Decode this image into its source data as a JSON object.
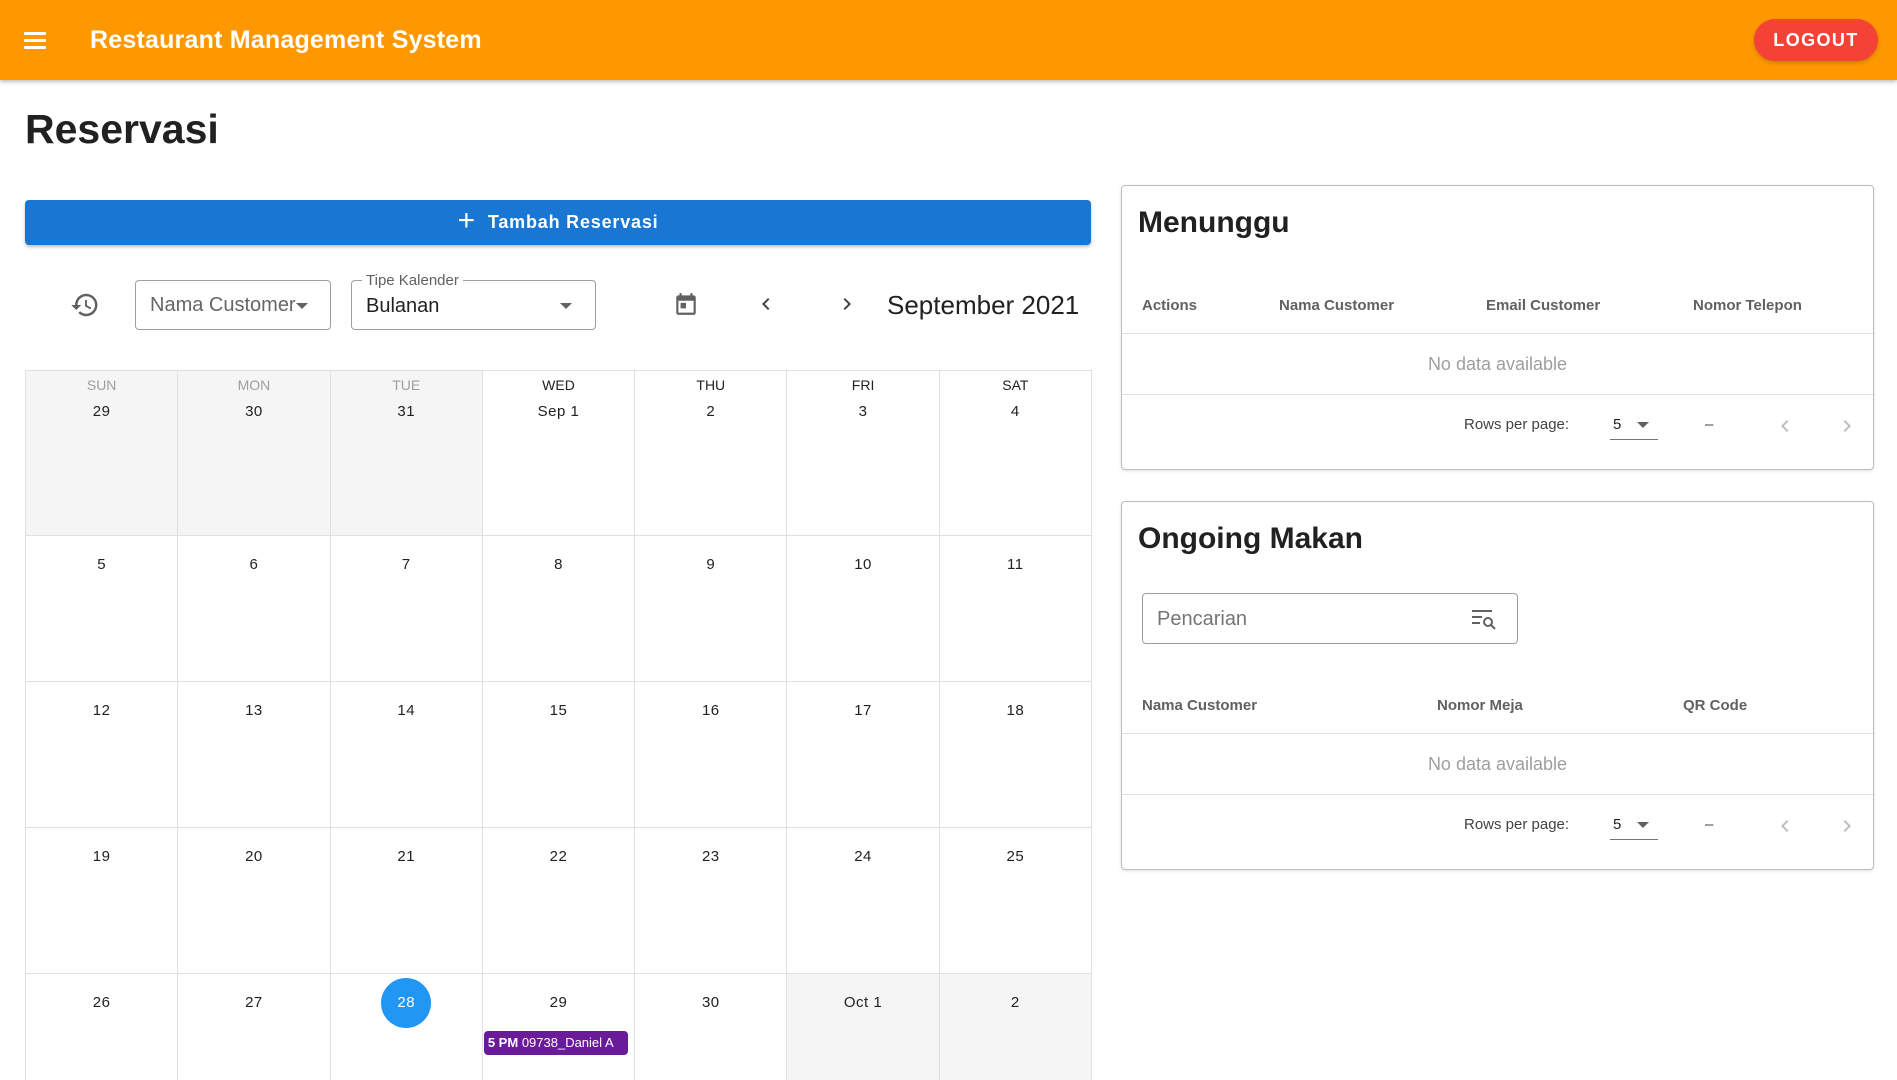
{
  "app": {
    "title": "Restaurant Management System",
    "logout_label": "LOGOUT"
  },
  "page": {
    "title": "Reservasi",
    "add_label": "Tambah Reservasi"
  },
  "toolbar": {
    "customer_select_value": "Nama Customer",
    "calendar_type_label": "Tipe Kalender",
    "calendar_type_value": "Bulanan",
    "month_title": "September 2021"
  },
  "calendar": {
    "weekdays": [
      "SUN",
      "MON",
      "TUE",
      "WED",
      "THU",
      "FRI",
      "SAT"
    ],
    "weeks": [
      [
        "29",
        "30",
        "31",
        "Sep 1",
        "2",
        "3",
        "4"
      ],
      [
        "5",
        "6",
        "7",
        "8",
        "9",
        "10",
        "11"
      ],
      [
        "12",
        "13",
        "14",
        "15",
        "16",
        "17",
        "18"
      ],
      [
        "19",
        "20",
        "21",
        "22",
        "23",
        "24",
        "25"
      ],
      [
        "26",
        "27",
        "28",
        "29",
        "30",
        "Oct 1",
        "2"
      ]
    ],
    "event": {
      "time": "5 PM",
      "title": "09738_Daniel A"
    }
  },
  "menunggu": {
    "title": "Menunggu",
    "headers": [
      "Actions",
      "Nama Customer",
      "Email Customer",
      "Nomor Telepon"
    ],
    "empty_text": "No data available",
    "rows_per_page_label": "Rows per page:",
    "rows_per_page_value": "5",
    "range_text": "–"
  },
  "ongoing": {
    "title": "Ongoing Makan",
    "search_placeholder": "Pencarian",
    "headers": [
      "Nama Customer",
      "Nomor Meja",
      "QR Code"
    ],
    "empty_text": "No data available",
    "rows_per_page_label": "Rows per page:",
    "rows_per_page_value": "5",
    "range_text": "–"
  }
}
